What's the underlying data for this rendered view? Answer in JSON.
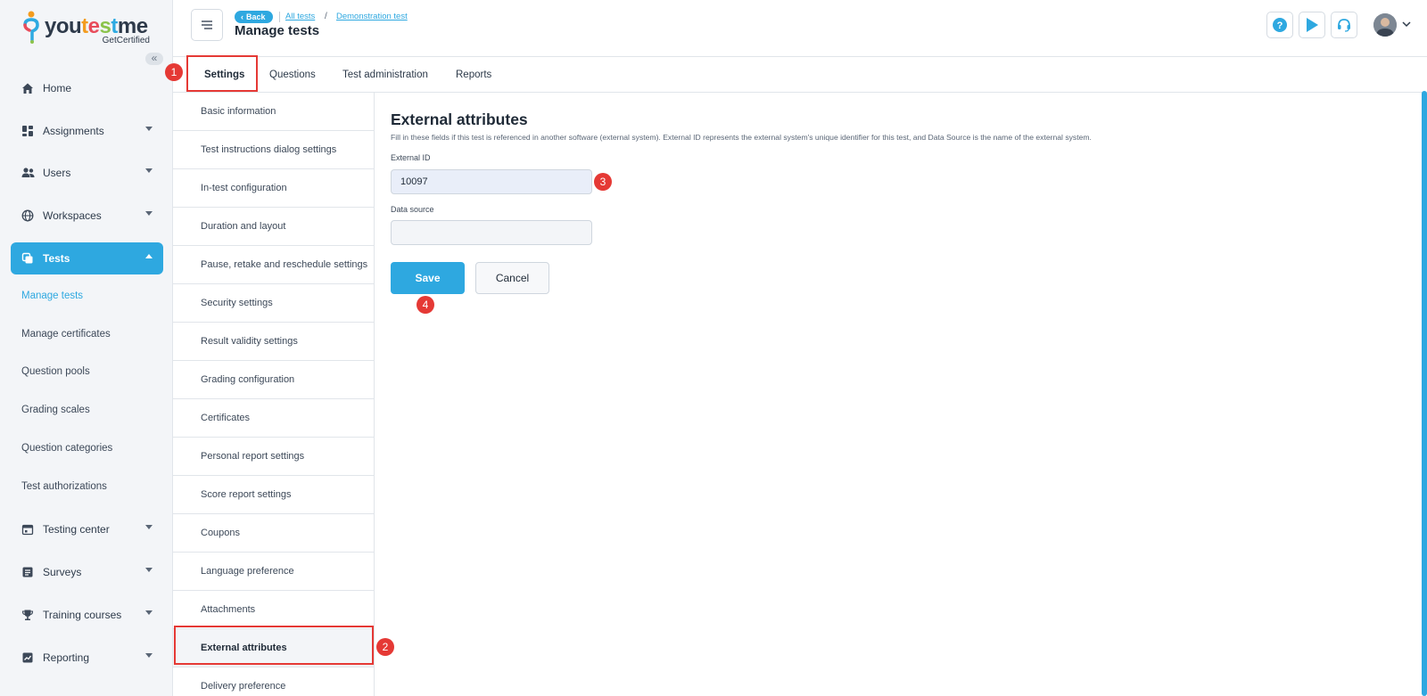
{
  "brand": {
    "name_parts": [
      "you",
      "t",
      "e",
      "s",
      "t",
      "me"
    ],
    "tagline": "GetCertified",
    "accent_color": "#2ea8e0",
    "annotation_color": "#e53935"
  },
  "sidebar": {
    "collapse_icon": "double-chevron-left-icon",
    "items": [
      {
        "label": "Home",
        "icon": "home-icon"
      },
      {
        "label": "Assignments",
        "icon": "dashboard-icon"
      },
      {
        "label": "Users",
        "icon": "users-icon"
      },
      {
        "label": "Workspaces",
        "icon": "globe-icon"
      },
      {
        "label": "Tests",
        "icon": "copy-icon"
      },
      {
        "label": "Testing center",
        "icon": "calendar-icon"
      },
      {
        "label": "Surveys",
        "icon": "list-icon"
      },
      {
        "label": "Training courses",
        "icon": "trophy-icon"
      },
      {
        "label": "Reporting",
        "icon": "chart-icon"
      }
    ],
    "tests_subitems": [
      "Manage tests",
      "Manage certificates",
      "Question pools",
      "Grading scales",
      "Question categories",
      "Test authorizations"
    ]
  },
  "header": {
    "back_label": "Back",
    "breadcrumb": [
      "All tests",
      "Demonstration test"
    ],
    "separator": "/",
    "title": "Manage tests",
    "buttons": [
      "help-icon",
      "play-icon",
      "headset-icon"
    ]
  },
  "tabs": [
    "Settings",
    "Questions",
    "Test administration",
    "Reports"
  ],
  "settings_menu": [
    "Basic information",
    "Test instructions dialog settings",
    "In-test configuration",
    "Duration and layout",
    "Pause, retake and reschedule settings",
    "Security settings",
    "Result validity settings",
    "Grading configuration",
    "Certificates",
    "Personal report settings",
    "Score report settings",
    "Coupons",
    "Language preference",
    "Attachments",
    "External attributes",
    "Delivery preference"
  ],
  "content": {
    "title": "External attributes",
    "description": "Fill in these fields if this test is referenced in another software (external system). External ID represents the external system's unique identifier for this test, and Data Source is the name of the external system.",
    "external_id_label": "External ID",
    "external_id_value": "10097",
    "data_source_label": "Data source",
    "data_source_value": "",
    "save_label": "Save",
    "cancel_label": "Cancel"
  },
  "annotations": [
    "1",
    "2",
    "3",
    "4"
  ]
}
